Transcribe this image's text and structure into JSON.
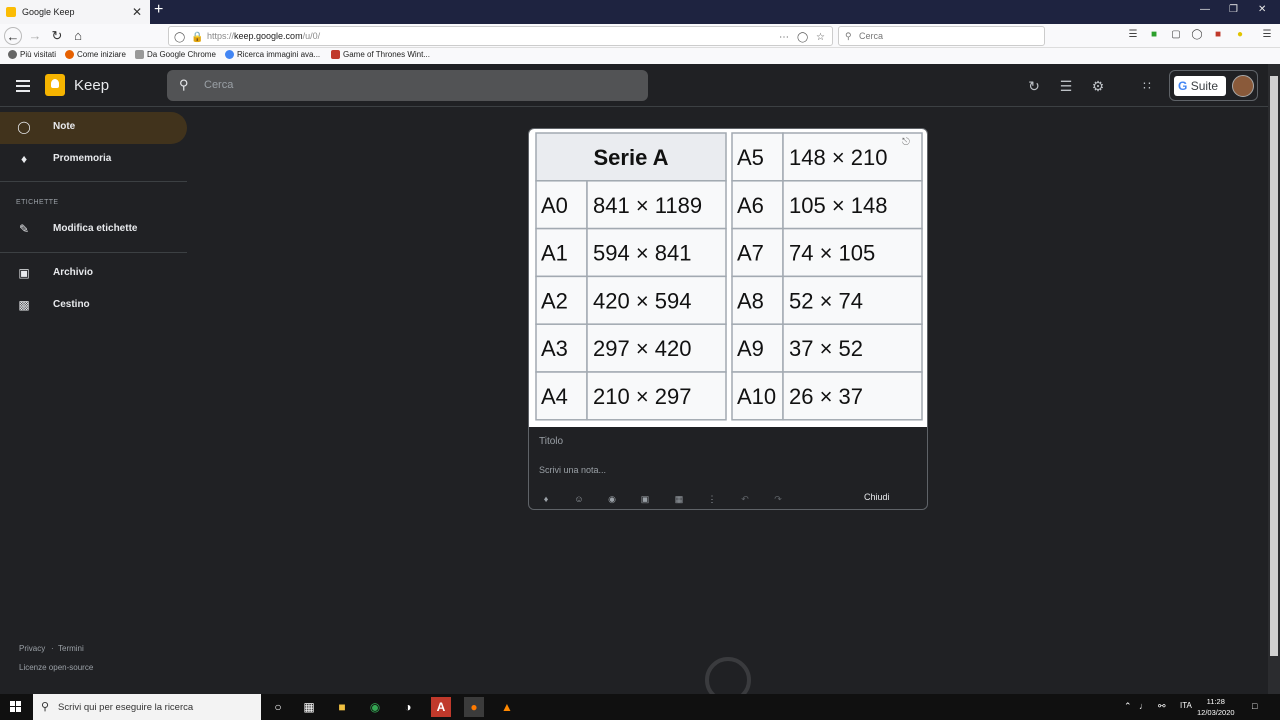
{
  "browser": {
    "tab_title": "Google Keep",
    "tab_close": "✕",
    "new_tab": "+",
    "url_prefix": "https://",
    "url_domain": "keep.google.com",
    "url_path": "/u/0/",
    "search_placeholder": "Cerca",
    "bookmarks": [
      {
        "label": "Più visitati",
        "icon": "gear-icon",
        "color": "#555555"
      },
      {
        "label": "Come iniziare",
        "icon": "firefox-icon",
        "color": "#e66000"
      },
      {
        "label": "Da Google Chrome",
        "icon": "folder-icon",
        "color": "#888888"
      },
      {
        "label": "Ricerca immagini ava...",
        "icon": "google-icon",
        "color": "#4285f4"
      },
      {
        "label": "Game of Thrones Wint...",
        "icon": "gt-icon",
        "color": "#c0392b"
      }
    ]
  },
  "keep": {
    "app_name": "Keep",
    "search_placeholder": "Cerca",
    "gsuite_label": "Suite",
    "gsuite_g": "G",
    "accent_color": "#f6b400",
    "sidebar": {
      "items": [
        {
          "label": "Note",
          "icon": "lightbulb-icon",
          "active": true
        },
        {
          "label": "Promemoria",
          "icon": "bell-icon",
          "active": false
        }
      ],
      "labels_section": "ETICHETTE",
      "edit_labels": "Modifica etichette",
      "archive": "Archivio",
      "trash": "Cestino",
      "footer": {
        "privacy": "Privacy",
        "separator": "·",
        "terms": "Termini",
        "licenses": "Licenze open-source"
      }
    },
    "note": {
      "title_placeholder": "Titolo",
      "body_placeholder": "Scrivi una nota...",
      "close_label": "Chiudi",
      "image_table": {
        "header": "Serie A",
        "left": [
          {
            "code": "A0",
            "size": "841 × 1189"
          },
          {
            "code": "A1",
            "size": "594 × 841"
          },
          {
            "code": "A2",
            "size": "420 × 594"
          },
          {
            "code": "A3",
            "size": "297 × 420"
          },
          {
            "code": "A4",
            "size": "210 × 297"
          }
        ],
        "right": [
          {
            "code": "A5",
            "size": "148 × 210"
          },
          {
            "code": "A6",
            "size": "105 × 148"
          },
          {
            "code": "A7",
            "size": "74 × 105"
          },
          {
            "code": "A8",
            "size": "52 × 74"
          },
          {
            "code": "A9",
            "size": "37 × 52"
          },
          {
            "code": "A10",
            "size": "26 × 37"
          }
        ]
      }
    }
  },
  "taskbar": {
    "search_placeholder": "Scrivi qui per eseguire la ricerca",
    "language": "ITA",
    "time": "11:28",
    "date": "12/03/2020"
  }
}
